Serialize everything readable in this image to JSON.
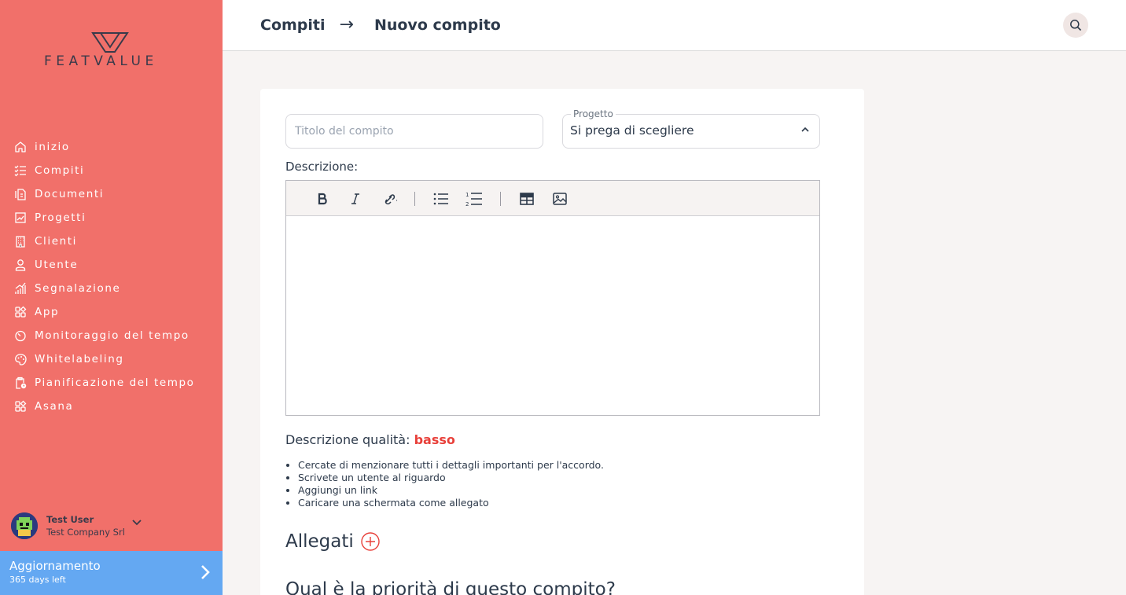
{
  "brand": {
    "name": "FEATVALUE"
  },
  "sidebar": {
    "items": [
      {
        "label": "inizio",
        "icon": "home-icon"
      },
      {
        "label": "Compiti",
        "icon": "tasks-icon"
      },
      {
        "label": "Documenti",
        "icon": "documents-icon"
      },
      {
        "label": "Progetti",
        "icon": "projects-icon"
      },
      {
        "label": "Clienti",
        "icon": "clients-icon"
      },
      {
        "label": "Utente",
        "icon": "user-icon"
      },
      {
        "label": "Segnalazione",
        "icon": "report-icon"
      },
      {
        "label": "App",
        "icon": "apps-icon"
      },
      {
        "label": "Monitoraggio del tempo",
        "icon": "timer-icon"
      },
      {
        "label": "Whitelabeling",
        "icon": "palette-icon"
      },
      {
        "label": "Pianificazione del tempo",
        "icon": "schedule-icon"
      },
      {
        "label": "Asana",
        "icon": "apps-icon"
      }
    ],
    "user": {
      "name": "Test User",
      "company": "Test Company Srl"
    },
    "upgrade": {
      "title": "Aggiornamento",
      "subtitle": "365 days left"
    }
  },
  "header": {
    "breadcrumb_parent": "Compiti",
    "breadcrumb_arrow": "→",
    "breadcrumb_current": "Nuovo compito"
  },
  "form": {
    "title_placeholder": "Titolo del compito",
    "title_value": "",
    "project_label": "Progetto",
    "project_value": "Si prega di scegliere",
    "description_label": "Descrizione:",
    "quality_label": "Descrizione qualità:",
    "quality_level": "basso",
    "tips": [
      "Cercate di menzionare tutti i dettagli importanti per l'accordo.",
      "Scrivete un utente al riguardo",
      "Aggiungi un link",
      "Caricare una schermata come allegato"
    ],
    "attachments_label": "Allegati",
    "priority_question": "Qual è la priorità di questo compito?"
  },
  "colors": {
    "sidebar": "#f1706a",
    "upgrade": "#64a8f2",
    "accent_red": "#e8403a",
    "text": "#2d3a4b"
  }
}
